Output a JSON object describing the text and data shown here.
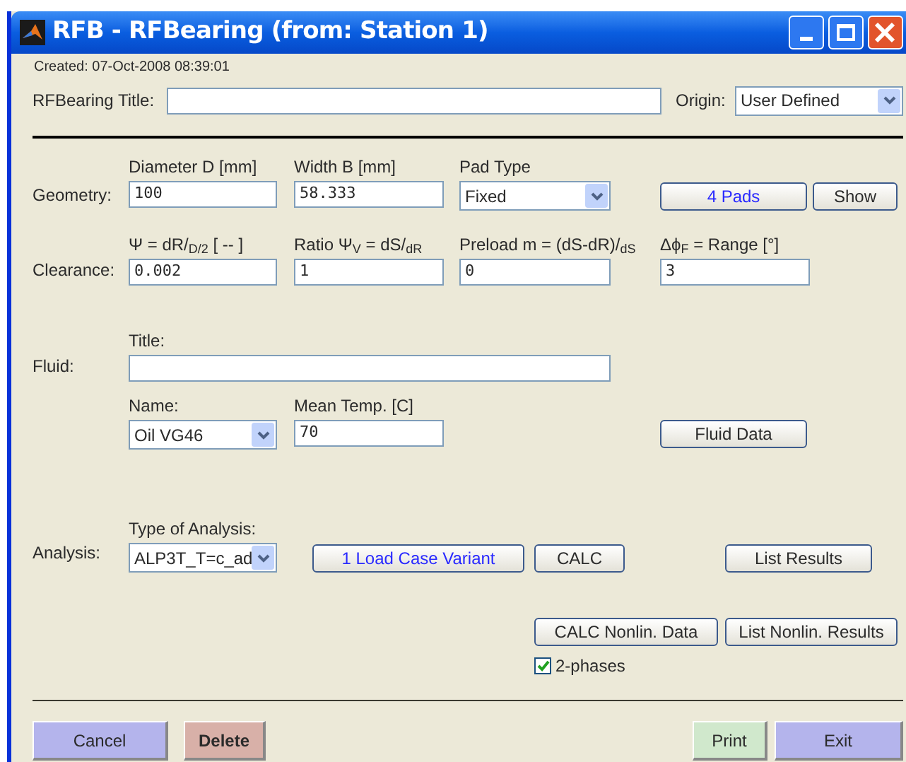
{
  "window": {
    "title": "RFB - RFBearing (from: Station 1)"
  },
  "created": "Created: 07-Oct-2008 08:39:01",
  "title_field": {
    "label": "RFBearing Title:"
  },
  "origin": {
    "label": "Origin:",
    "value": "User Defined"
  },
  "geometry": {
    "label": "Geometry:",
    "fields": [
      {
        "kind": "input",
        "label": "Diameter D [mm]",
        "value": "100"
      },
      {
        "kind": "input",
        "label": "Width B [mm]",
        "value": "58.333"
      },
      {
        "kind": "select",
        "label": "Pad Type",
        "value": "Fixed"
      }
    ],
    "buttons": [
      {
        "label": "4 Pads",
        "emphasis": true
      },
      {
        "label": "Show",
        "emphasis": false
      }
    ]
  },
  "clearance": {
    "label": "Clearance:",
    "fields": [
      {
        "kind": "input",
        "label": "Ψ = dR/$_{D/2}$ [ -- ]",
        "value": "0.002"
      },
      {
        "kind": "input",
        "label": "Ratio Ψ$_{V}$ = dS/$_{dR}$",
        "value": "1"
      },
      {
        "kind": "input",
        "label": "Preload m = (dS-dR)/$_{dS}$",
        "value": "0"
      },
      {
        "kind": "input",
        "label": "Δϕ$_{F}$ = Range [°]",
        "value": "3"
      }
    ]
  },
  "fluid": {
    "label": "Fluid:",
    "title_field": {
      "label": "Title:"
    },
    "fields": [
      {
        "kind": "select",
        "label": "Name:",
        "value": "Oil VG46"
      },
      {
        "kind": "input",
        "label": "Mean Temp. [C]",
        "value": "70"
      }
    ],
    "buttons": [
      {
        "label": "Fluid Data",
        "emphasis": false
      }
    ]
  },
  "analysis": {
    "label": "Analysis:",
    "type_field": {
      "kind": "select",
      "label": "Type of Analysis:",
      "value": "ALP3T_T=c_ad"
    },
    "buttons": [
      {
        "label": "1 Load Case Variant",
        "emphasis": true
      },
      {
        "label": "CALC",
        "emphasis": false
      },
      {
        "label": "List Results",
        "emphasis": false
      },
      {
        "label": "CALC Nonlin. Data",
        "emphasis": false
      },
      {
        "label": "List Nonlin. Results",
        "emphasis": false
      }
    ],
    "two_phases": {
      "label": "2-phases",
      "checked": true
    }
  },
  "footer": {
    "buttons": [
      {
        "label": "Cancel",
        "color": "#b4b4ec",
        "bold": false
      },
      {
        "label": "Delete",
        "color": "#d8b0a8",
        "bold": true
      },
      {
        "label": "Print",
        "color": "#d0e8cc",
        "bold": false
      },
      {
        "label": "Exit",
        "color": "#b4b4ec",
        "bold": false
      }
    ]
  }
}
